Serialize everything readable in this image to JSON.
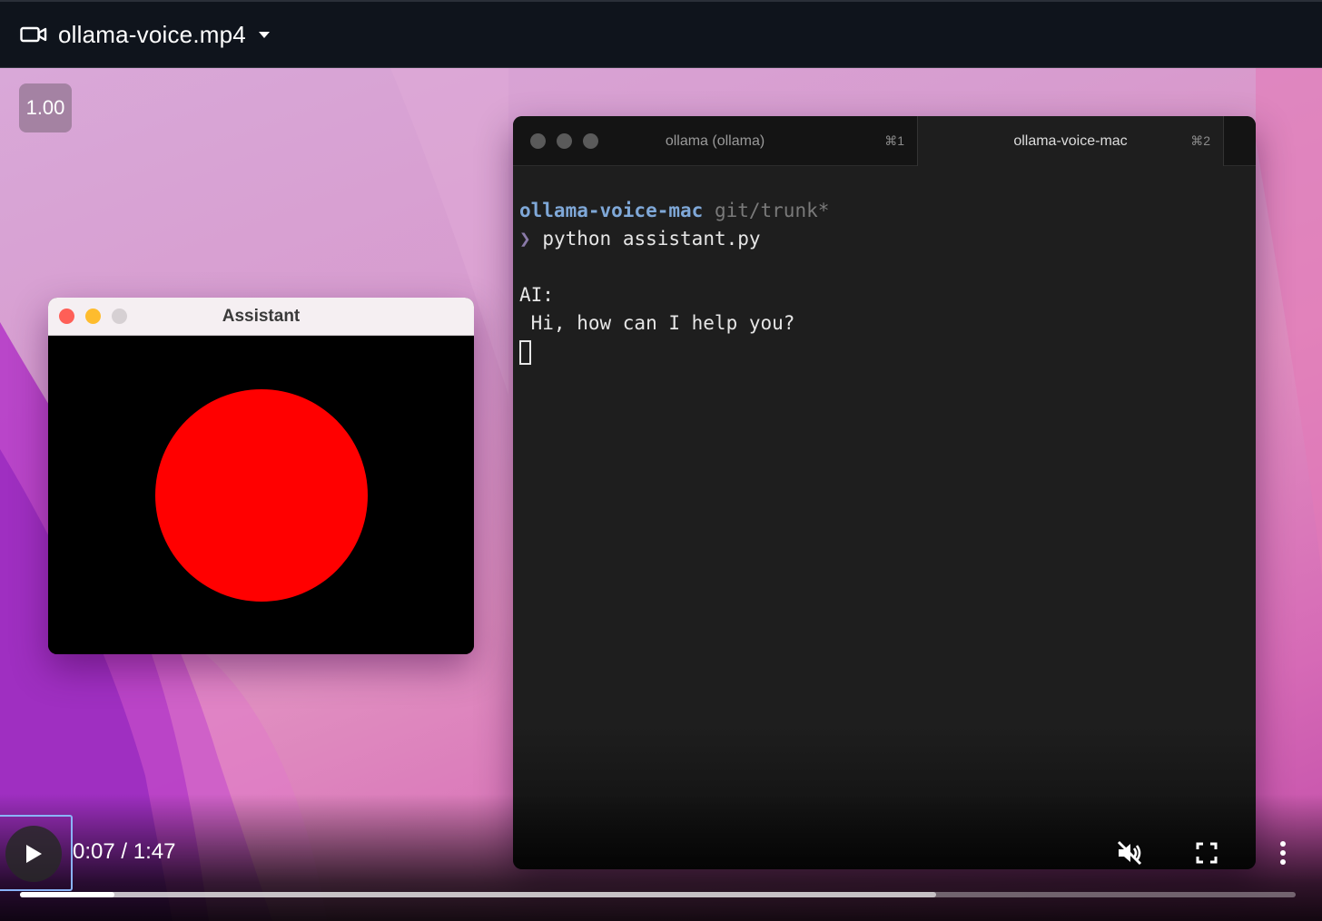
{
  "file_bar": {
    "filename": "ollama-voice.mp4",
    "icon": "video-camera-icon"
  },
  "video": {
    "speed_label": "1.00",
    "assistant_window": {
      "title": "Assistant",
      "circle_color": "#ff0000"
    },
    "terminal": {
      "tabs": [
        {
          "label": "ollama (ollama)",
          "shortcut": "⌘1"
        },
        {
          "label": "ollama-voice-mac",
          "shortcut": "⌘2"
        }
      ],
      "lines": {
        "directory": "ollama-voice-mac",
        "branch": "git/trunk*",
        "prompt_symbol": "❯",
        "command": "python assistant.py",
        "ai_label": "AI:",
        "ai_response": " Hi, how can I help you?"
      }
    }
  },
  "controls": {
    "current_time": "0:07",
    "separator": "/",
    "duration": "1:47",
    "progress_fraction": 0.074,
    "buffered_fraction": 0.718,
    "mute_icon": "volume-muted-icon",
    "fullscreen_icon": "fullscreen-icon",
    "more_icon": "more-vertical-icon"
  }
}
